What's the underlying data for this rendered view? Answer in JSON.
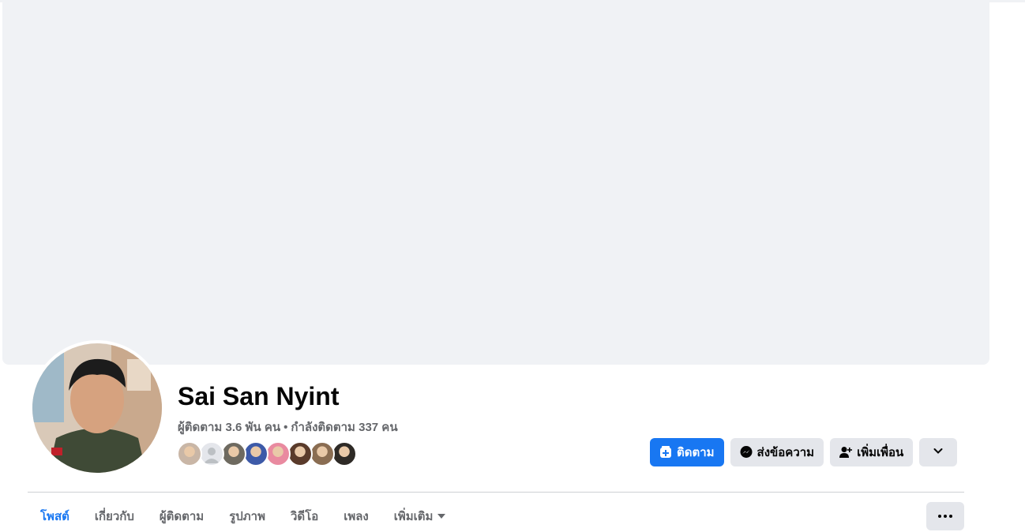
{
  "profile": {
    "name": "Sai San Nyint",
    "followers_text": "ผู้ติดตาม 3.6 พัน คน",
    "separator": "•",
    "following_text": "กำลังติดตาม 337 คน"
  },
  "friends_preview": [
    {
      "avatar": "friend-avatar-1",
      "color": "#c9b6a6"
    },
    {
      "avatar": "default-avatar",
      "color": "#bcc0c4"
    },
    {
      "avatar": "friend-avatar-3",
      "color": "#6e6a60"
    },
    {
      "avatar": "friend-avatar-4",
      "color": "#3d5aa8"
    },
    {
      "avatar": "friend-avatar-5",
      "color": "#e98aa0"
    },
    {
      "avatar": "friend-avatar-6",
      "color": "#5a3b2b"
    },
    {
      "avatar": "friend-avatar-7",
      "color": "#8a6d52"
    },
    {
      "avatar": "friend-avatar-8",
      "color": "#2e2a26"
    }
  ],
  "actions": {
    "follow_label": "ติดตาม",
    "message_label": "ส่งข้อความ",
    "add_friend_label": "เพิ่มเพื่อน"
  },
  "tabs": [
    {
      "label": "โพสต์",
      "active": true
    },
    {
      "label": "เกี่ยวกับ",
      "active": false
    },
    {
      "label": "ผู้ติดตาม",
      "active": false
    },
    {
      "label": "รูปภาพ",
      "active": false
    },
    {
      "label": "วิดีโอ",
      "active": false
    },
    {
      "label": "เพลง",
      "active": false
    },
    {
      "label": "เพิ่มเติม",
      "active": false
    }
  ],
  "colors": {
    "accent": "#1877f2",
    "secondary_button": "#e4e6eb",
    "cover": "#f0f2f5",
    "muted_text": "#65676b"
  }
}
